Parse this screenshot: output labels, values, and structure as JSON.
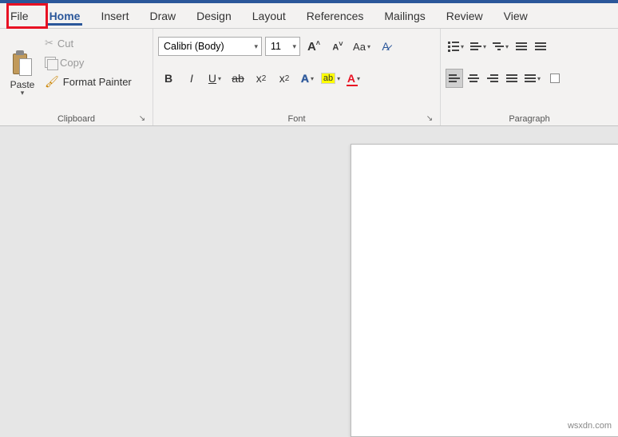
{
  "tabs": {
    "file": "File",
    "home": "Home",
    "insert": "Insert",
    "draw": "Draw",
    "design": "Design",
    "layout": "Layout",
    "references": "References",
    "mailings": "Mailings",
    "review": "Review",
    "view": "View"
  },
  "clipboard": {
    "paste": "Paste",
    "cut": "Cut",
    "copy": "Copy",
    "format_painter": "Format Painter",
    "group_label": "Clipboard"
  },
  "font": {
    "name": "Calibri (Body)",
    "size": "11",
    "group_label": "Font"
  },
  "paragraph": {
    "group_label": "Paragraph"
  },
  "watermark": "wsxdn.com"
}
